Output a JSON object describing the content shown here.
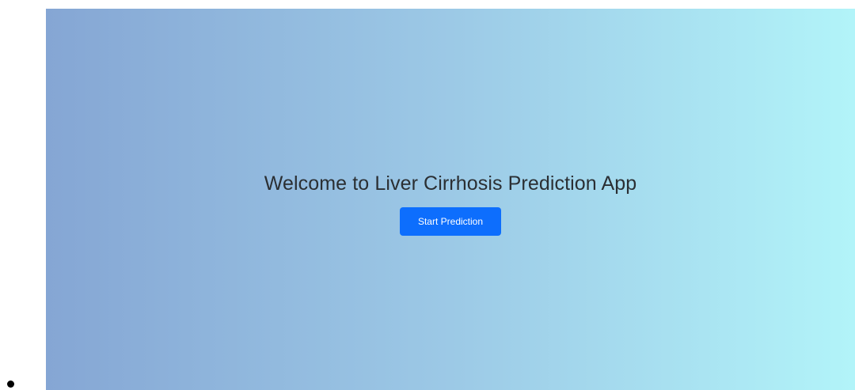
{
  "hero": {
    "title": "Welcome to Liver Cirrhosis Prediction App",
    "start_button_label": "Start Prediction"
  },
  "colors": {
    "gradient_start": "#85a6d4",
    "gradient_end": "#b2f4f9",
    "button_primary": "#0d6efd",
    "title_text": "#2b2f33"
  }
}
